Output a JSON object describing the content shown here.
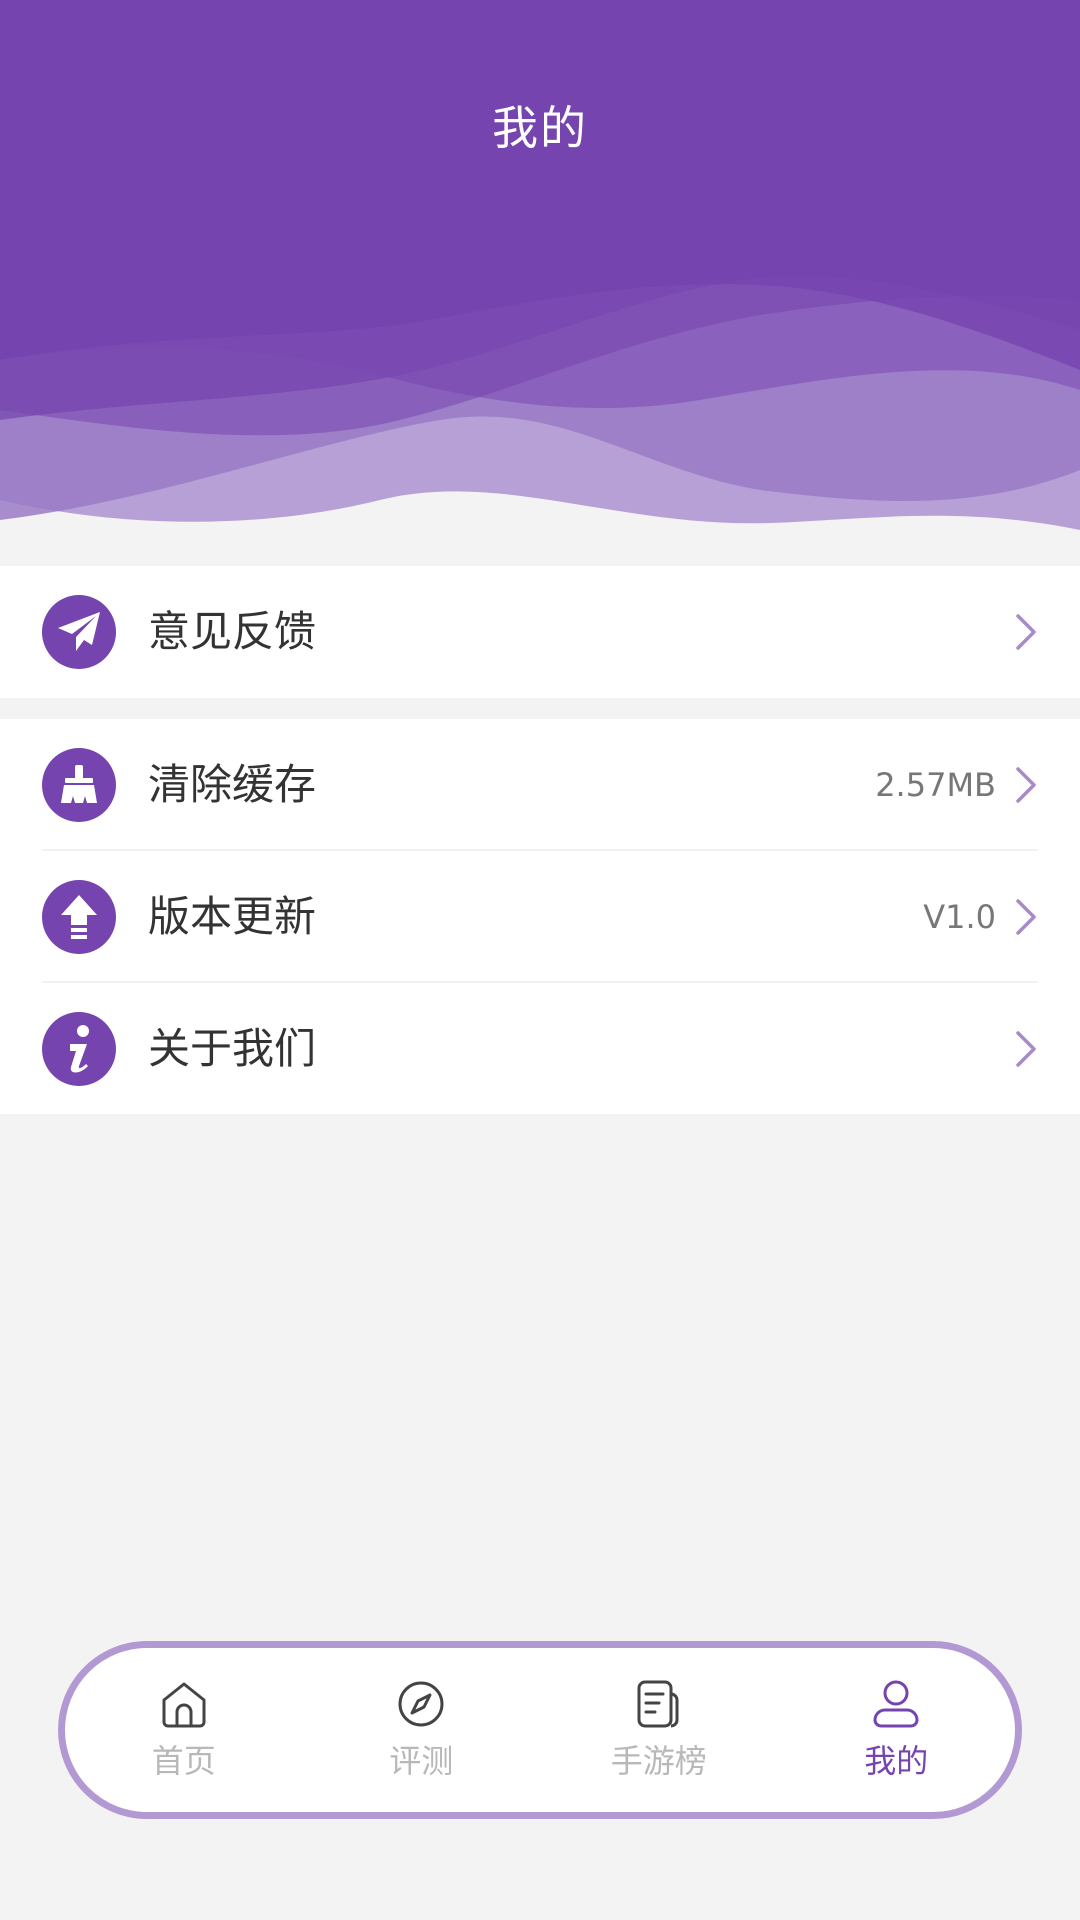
{
  "header": {
    "title": "我的"
  },
  "menu": [
    {
      "id": "feedback",
      "label": "意见反馈",
      "value": "",
      "icon": "paper-plane-icon"
    },
    {
      "id": "clear-cache",
      "label": "清除缓存",
      "value": "2.57MB",
      "icon": "broom-icon"
    },
    {
      "id": "version-update",
      "label": "版本更新",
      "value": "V1.0",
      "icon": "upload-arrow-icon"
    },
    {
      "id": "about-us",
      "label": "关于我们",
      "value": "",
      "icon": "info-icon"
    }
  ],
  "tabs": [
    {
      "label": "首页",
      "icon": "home-icon",
      "active": false
    },
    {
      "label": "评测",
      "icon": "compass-icon",
      "active": false
    },
    {
      "label": "手游榜",
      "icon": "document-list-icon",
      "active": false
    },
    {
      "label": "我的",
      "icon": "user-icon",
      "active": true
    }
  ],
  "colors": {
    "accent": "#7644ae",
    "wave_light": "#b399d3",
    "background": "#f3f3f3",
    "tab_inactive": "#b8b8b8"
  }
}
